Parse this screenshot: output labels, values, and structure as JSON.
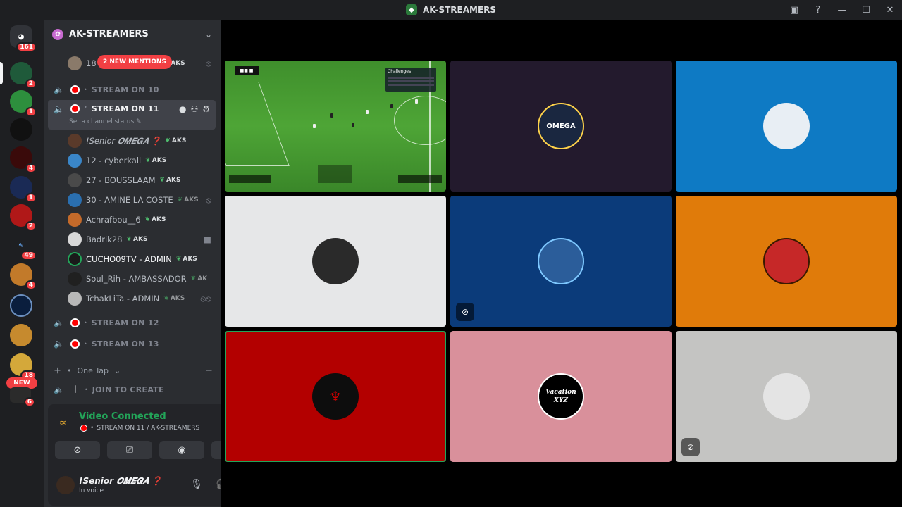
{
  "window": {
    "title": "AK-STREAMERS"
  },
  "guild_bar": {
    "home_badge": "161",
    "guilds": [
      {
        "badge": "2"
      },
      {
        "badge": "1"
      },
      {
        "badge": ""
      },
      {
        "badge": "4"
      },
      {
        "badge": "1"
      },
      {
        "badge": "2"
      },
      {
        "badge": "49"
      },
      {
        "badge": "4"
      },
      {
        "badge": ""
      },
      {
        "badge": ""
      },
      {
        "badge": "18"
      },
      {
        "badge": "6"
      }
    ],
    "new_label": "NEW"
  },
  "server": {
    "name": "AK-STREAMERS"
  },
  "mentions_label": "2 NEW MENTIONS",
  "top_member": {
    "name": "18",
    "tag": "AKS"
  },
  "channels": {
    "stream10": "STREAM ON 10",
    "stream11": "STREAM ON 11",
    "stream11_status": "Set a channel status",
    "stream12": "STREAM ON 12",
    "stream13": "STREAM ON 13",
    "join": "JOIN TO CREATE"
  },
  "members": [
    {
      "name": "!Senior 𝑶𝑴𝑬𝑮𝑨 ❓",
      "tag": "AKS"
    },
    {
      "name": "12 - cyberkall",
      "tag": "AKS"
    },
    {
      "name": "27 - BOUSSLAAM",
      "tag": "AKS"
    },
    {
      "name": "30 - AMINE LA COSTE",
      "tag": "AKS"
    },
    {
      "name": "Achrafbou__6",
      "tag": "AKS"
    },
    {
      "name": "Badrik28",
      "tag": "AKS"
    },
    {
      "name": "CUCHO09TV - ADMIN",
      "tag": "AKS"
    },
    {
      "name": "Soul_Rih - AMBASSADOR",
      "tag": "AK"
    },
    {
      "name": "TchakLiTa - ADMIN",
      "tag": "AKS"
    }
  ],
  "category": {
    "name": "One Tap"
  },
  "voice": {
    "title": "Video Connected",
    "subtitle": "STREAM ON 11 / AK-STREAMERS"
  },
  "user": {
    "name": "!Senior 𝑶𝑴𝑬𝑮𝑨 ❓",
    "status": "In voice"
  },
  "game_board": {
    "title": "Challenges"
  },
  "tiles": [
    {
      "label": "OMEGA"
    },
    {
      "label": "Vacation XYZ"
    }
  ],
  "colors": {
    "speaking": "#23a559",
    "mention": "#f23f43",
    "tile2_bg": "#231a2d",
    "tile3_bg": "#0e7ac4",
    "tile4_bg": "#e6e7e8",
    "tile5_bg": "#0b3b7a",
    "tile6_bg": "#e07b0a",
    "tile7_bg": "#b30000",
    "tile8_bg": "#d9909b",
    "tile9_bg": "#c4c4c2"
  }
}
